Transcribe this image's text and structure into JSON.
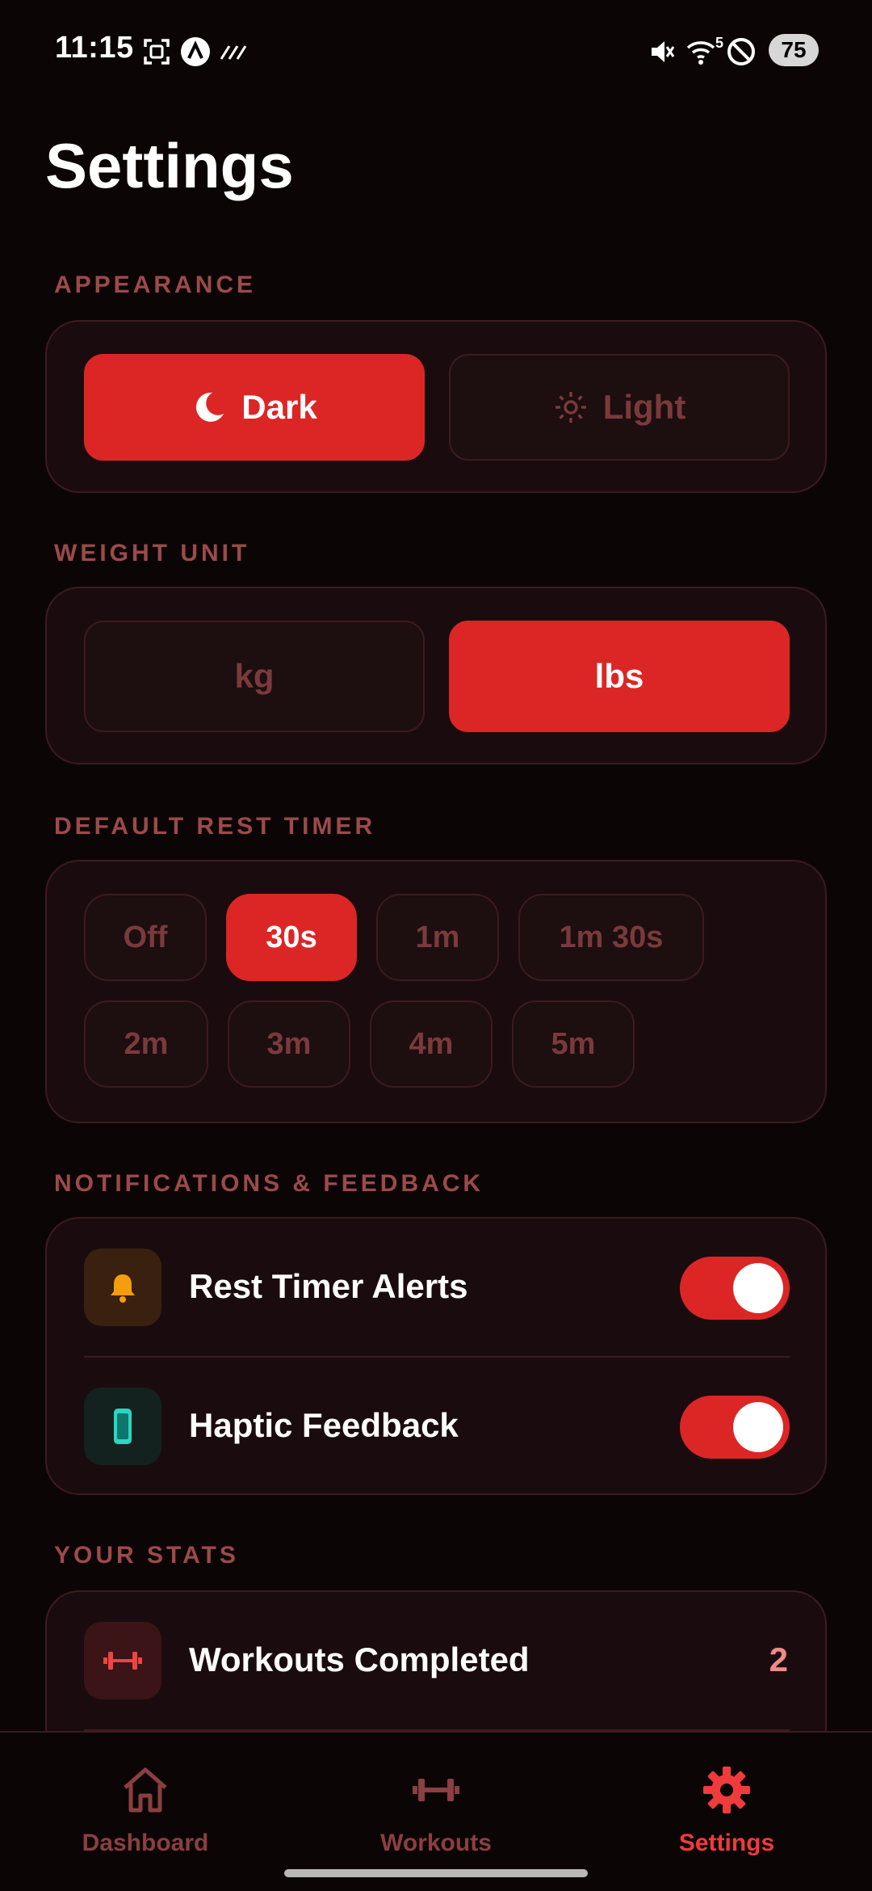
{
  "status_bar": {
    "time": "11:15",
    "battery": "75",
    "wifi_badge": "5"
  },
  "page": {
    "title": "Settings"
  },
  "appearance": {
    "label": "APPEARANCE",
    "options": [
      {
        "label": "Dark",
        "icon": "moon-icon",
        "selected": true
      },
      {
        "label": "Light",
        "icon": "sun-icon",
        "selected": false
      }
    ]
  },
  "weight_unit": {
    "label": "WEIGHT UNIT",
    "options": [
      {
        "label": "kg",
        "selected": false
      },
      {
        "label": "lbs",
        "selected": true
      }
    ]
  },
  "rest_timer": {
    "label": "DEFAULT REST TIMER",
    "options": [
      "Off",
      "30s",
      "1m",
      "1m 30s",
      "2m",
      "3m",
      "4m",
      "5m"
    ],
    "selected": "30s"
  },
  "notifications": {
    "label": "NOTIFICATIONS & FEEDBACK",
    "items": [
      {
        "label": "Rest Timer Alerts",
        "icon": "bell-icon",
        "enabled": true
      },
      {
        "label": "Haptic Feedback",
        "icon": "phone-icon",
        "enabled": true
      }
    ]
  },
  "stats": {
    "label": "YOUR STATS",
    "items": [
      {
        "label": "Workouts Completed",
        "value": "2",
        "icon": "dumbbell-icon"
      }
    ]
  },
  "nav": {
    "items": [
      {
        "label": "Dashboard",
        "icon": "home-icon",
        "active": false
      },
      {
        "label": "Workouts",
        "icon": "dumbbell-icon",
        "active": false
      },
      {
        "label": "Settings",
        "icon": "gear-icon",
        "active": true
      }
    ]
  },
  "colors": {
    "accent": "#dc2626",
    "background": "#0c0506",
    "card": "#1a0c0e",
    "muted": "#7a3a3b"
  }
}
